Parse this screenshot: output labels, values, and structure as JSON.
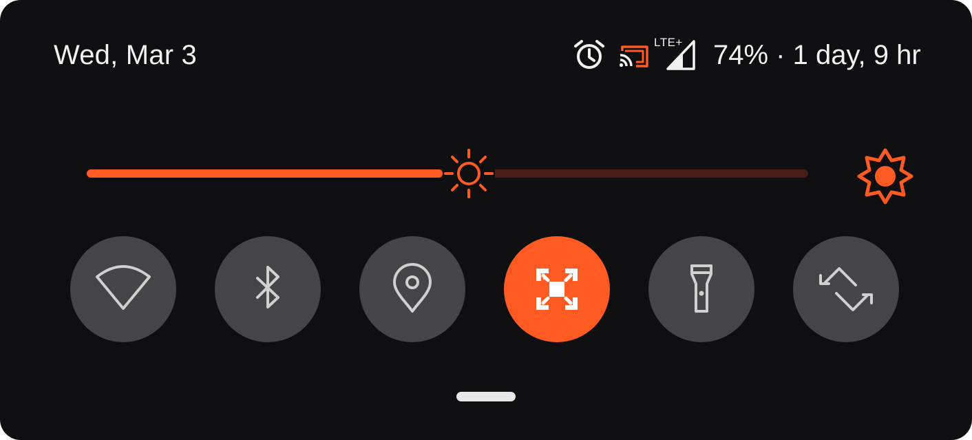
{
  "status_bar": {
    "date": "Wed, Mar 3",
    "network_type": "LTE+",
    "battery_text": "74% · 1 day, 9 hr",
    "icons": [
      "alarm-icon",
      "cast-icon",
      "cell-signal-icon"
    ]
  },
  "brightness": {
    "level": 0.53,
    "auto_icon": "auto-brightness-icon"
  },
  "tiles": [
    {
      "name": "wifi",
      "icon": "wifi-icon",
      "active": false
    },
    {
      "name": "bluetooth",
      "icon": "bluetooth-icon",
      "active": false
    },
    {
      "name": "location",
      "icon": "location-icon",
      "active": false
    },
    {
      "name": "screen-record",
      "icon": "screen-capture-icon",
      "active": true
    },
    {
      "name": "flashlight",
      "icon": "flashlight-icon",
      "active": false
    },
    {
      "name": "auto-rotate",
      "icon": "auto-rotate-icon",
      "active": false
    }
  ],
  "colors": {
    "accent": "#ff5a22",
    "track_inactive": "#471d15",
    "tile_inactive": "#454547",
    "background": "#0f0f11",
    "icon_inactive": "#d0d0d0",
    "text": "#f2f2f2"
  }
}
